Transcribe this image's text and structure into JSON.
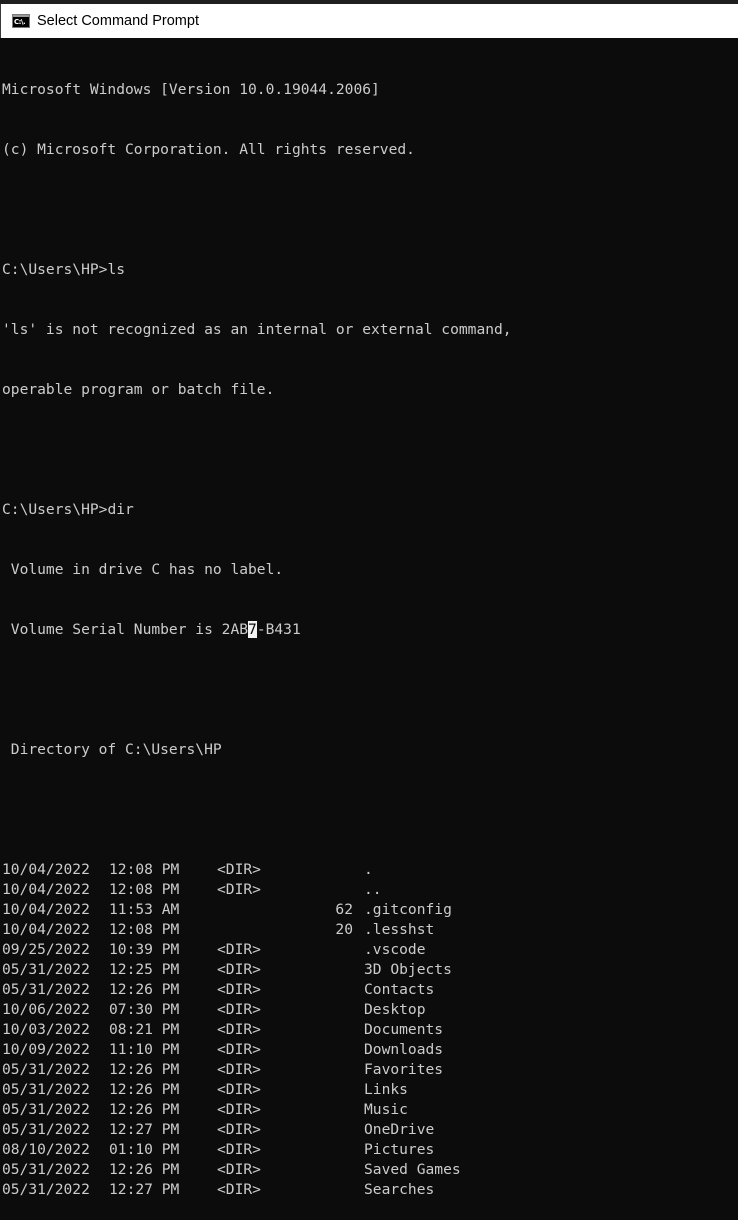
{
  "window": {
    "title": "Select Command Prompt",
    "icon": "cmd-icon",
    "icon_text": "C:\\."
  },
  "console": {
    "header": [
      "Microsoft Windows [Version 10.0.19044.2006]",
      "(c) Microsoft Corporation. All rights reserved."
    ],
    "commands": [
      {
        "prompt": "C:\\Users\\HP>",
        "command": "ls",
        "output": [
          "'ls' is not recognized as an internal or external command,",
          "operable program or batch file."
        ]
      },
      {
        "prompt": "C:\\Users\\HP>",
        "command": "dir",
        "volume_label_line": " Volume in drive C has no label.",
        "serial_prefix": " Volume Serial Number is 2AB",
        "serial_selected": "7",
        "serial_suffix": "-B431",
        "directory_line": " Directory of C:\\Users\\HP"
      }
    ],
    "listing": [
      {
        "date": "10/04/2022",
        "time": "12:08 PM",
        "type": "<DIR>",
        "size": "",
        "name": "."
      },
      {
        "date": "10/04/2022",
        "time": "12:08 PM",
        "type": "<DIR>",
        "size": "",
        "name": ".."
      },
      {
        "date": "10/04/2022",
        "time": "11:53 AM",
        "type": "",
        "size": "62",
        "name": ".gitconfig"
      },
      {
        "date": "10/04/2022",
        "time": "12:08 PM",
        "type": "",
        "size": "20",
        "name": ".lesshst"
      },
      {
        "date": "09/25/2022",
        "time": "10:39 PM",
        "type": "<DIR>",
        "size": "",
        "name": ".vscode"
      },
      {
        "date": "05/31/2022",
        "time": "12:25 PM",
        "type": "<DIR>",
        "size": "",
        "name": "3D Objects"
      },
      {
        "date": "05/31/2022",
        "time": "12:26 PM",
        "type": "<DIR>",
        "size": "",
        "name": "Contacts"
      },
      {
        "date": "10/06/2022",
        "time": "07:30 PM",
        "type": "<DIR>",
        "size": "",
        "name": "Desktop"
      },
      {
        "date": "10/03/2022",
        "time": "08:21 PM",
        "type": "<DIR>",
        "size": "",
        "name": "Documents"
      },
      {
        "date": "10/09/2022",
        "time": "11:10 PM",
        "type": "<DIR>",
        "size": "",
        "name": "Downloads"
      },
      {
        "date": "05/31/2022",
        "time": "12:26 PM",
        "type": "<DIR>",
        "size": "",
        "name": "Favorites"
      },
      {
        "date": "05/31/2022",
        "time": "12:26 PM",
        "type": "<DIR>",
        "size": "",
        "name": "Links"
      },
      {
        "date": "05/31/2022",
        "time": "12:26 PM",
        "type": "<DIR>",
        "size": "",
        "name": "Music"
      },
      {
        "date": "05/31/2022",
        "time": "12:27 PM",
        "type": "<DIR>",
        "size": "",
        "name": "OneDrive"
      },
      {
        "date": "08/10/2022",
        "time": "01:10 PM",
        "type": "<DIR>",
        "size": "",
        "name": "Pictures"
      },
      {
        "date": "05/31/2022",
        "time": "12:26 PM",
        "type": "<DIR>",
        "size": "",
        "name": "Saved Games"
      },
      {
        "date": "05/31/2022",
        "time": "12:27 PM",
        "type": "<DIR>",
        "size": "",
        "name": "Searches"
      }
    ]
  },
  "colors": {
    "console_bg": "#0c0c0c",
    "console_fg": "#cccccc",
    "selection_bg": "#f2f2f2",
    "titlebar_bg": "#ffffff"
  }
}
